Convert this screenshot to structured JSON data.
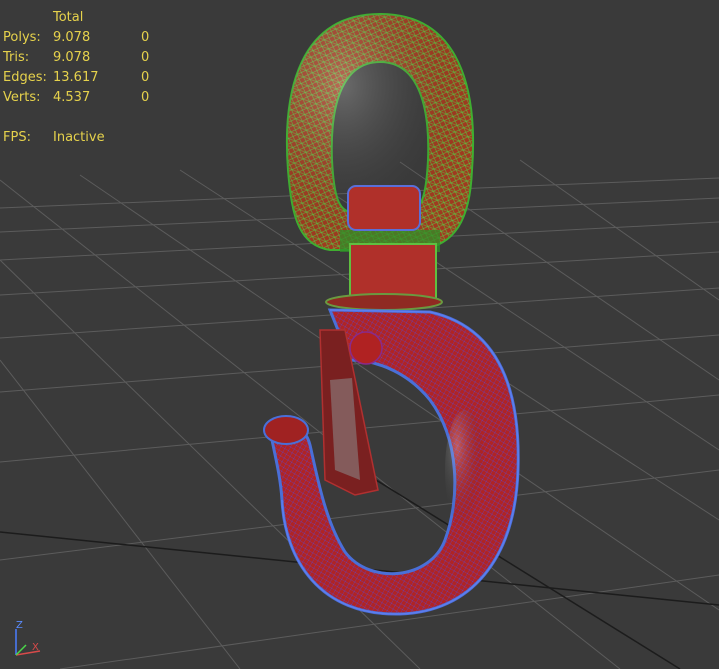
{
  "viewport": {
    "background": "#3a3a3a",
    "grid_color": "#5a5a5a",
    "colors": {
      "eye_wire": "#45a635",
      "eye_fill": "#b33a22",
      "hook_wire": "#4a6fd8",
      "hook_fill": "#b82a26"
    }
  },
  "stats": {
    "header": "Total",
    "rows": [
      {
        "label": "Polys:",
        "total": "9.078",
        "selected": "0"
      },
      {
        "label": "Tris:",
        "total": "9.078",
        "selected": "0"
      },
      {
        "label": "Edges:",
        "total": "13.617",
        "selected": "0"
      },
      {
        "label": "Verts:",
        "total": "4.537",
        "selected": "0"
      }
    ],
    "fps_label": "FPS:",
    "fps_value": "Inactive"
  },
  "gizmo": {
    "z_label": "Z",
    "x_label": "X"
  }
}
